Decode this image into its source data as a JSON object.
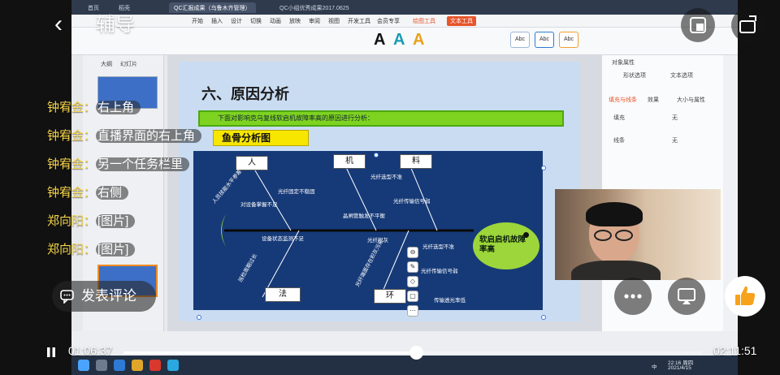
{
  "header": {
    "title": "辅导"
  },
  "chat": {
    "messages": [
      {
        "name": "钟宥金：",
        "text": "右上角"
      },
      {
        "name": "钟宥金：",
        "text": "直播界面的右上角"
      },
      {
        "name": "钟宥金：",
        "text": "另一个任务栏里"
      },
      {
        "name": "钟宥金：",
        "text": "右侧"
      },
      {
        "name": "郑向阳：",
        "text": "[图片]"
      },
      {
        "name": "郑向阳：",
        "text": "[图片]"
      }
    ]
  },
  "comment": {
    "label": "发表评论"
  },
  "player": {
    "current_time": "01:06:37",
    "total_time": "02:11:51",
    "progress": 0.505
  },
  "screen": {
    "wps_tabs": [
      "首页",
      "稻壳",
      "QC汇报成果（乌鲁木齐管理）",
      "QC小组优秀成果2017.0625"
    ],
    "menu": [
      "开始",
      "插入",
      "设计",
      "切换",
      "动画",
      "放映",
      "审阅",
      "视图",
      "开发工具",
      "会员专享",
      "绘图工具",
      "文本工具"
    ],
    "panel_tabs": [
      "大纲",
      "幻灯片"
    ],
    "right_panel": {
      "title": "对象属性",
      "tabs": [
        "形状选项",
        "文本选项"
      ],
      "subtabs": [
        "填充与线条",
        "效果",
        "大小与属性"
      ],
      "fill_label": "填充",
      "fill_value": "无",
      "line_label": "线条",
      "line_value": "无"
    },
    "slide": {
      "title": "六、原因分析",
      "banner": "下面对影响克乌复线软启机故障率高的原因进行分析：",
      "subtitle": "鱼骨分析图",
      "categories": {
        "people": "人",
        "machine": "机",
        "material": "料",
        "method": "法",
        "environment": "环"
      },
      "head": "软启启机故障率高",
      "causes": [
        "人员技能水平参差",
        "对设备掌握不足",
        "光纤固定不稳固",
        "光纤选型不准",
        "光纤传输信号弱",
        "晶闸管触发不平衡",
        "设备状态监测不足",
        "巡检周期过长",
        "光纤积灰",
        "光纤选型不准",
        "光纤传输信号弱",
        "传输透光率低",
        "光纤端面存在积灰污染"
      ]
    },
    "taskbar": {
      "clock": "22:16 周四",
      "date": "2021/4/15",
      "ime": "中"
    }
  },
  "colors": {
    "name": "#f6d64a",
    "slide_bg": "#c9dcf2",
    "banner": "#7ed321",
    "fish_head": "#9cd63a",
    "highlight": "#f6e600"
  }
}
